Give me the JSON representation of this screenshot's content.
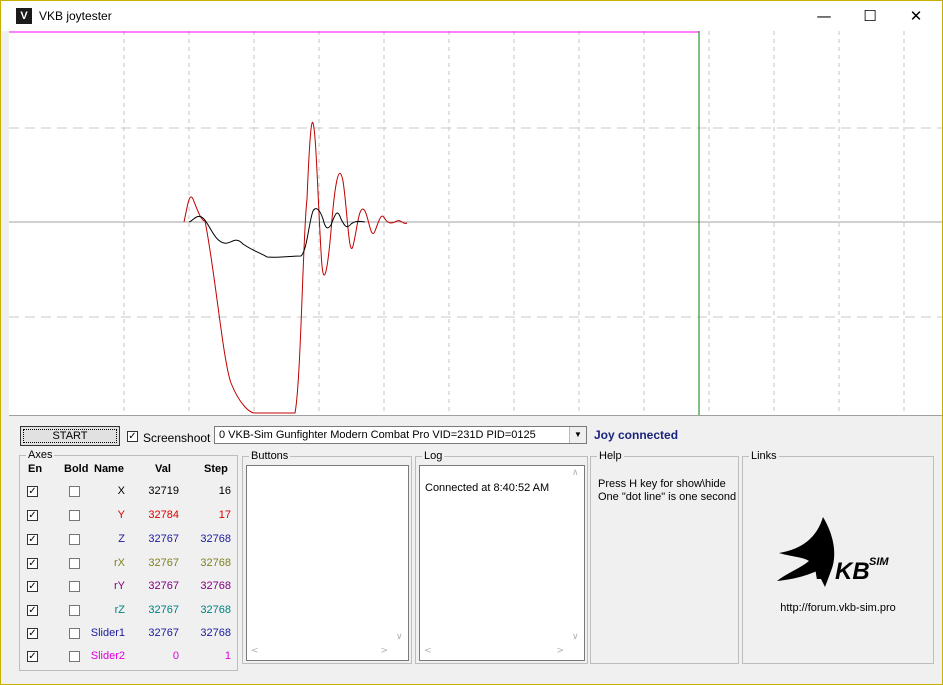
{
  "window": {
    "title": "VKB joytester",
    "min_glyph": "—",
    "max_glyph": "☐",
    "close_glyph": "✕"
  },
  "toolbar": {
    "start_label": "START",
    "screenshoot_checked": true,
    "screenshoot_label": "Screenshoot",
    "device_selected": "0  VKB-Sim Gunfighter Modern Combat Pro  VID=231D PID=0125",
    "status": "Joy connected"
  },
  "axes": {
    "title": "Axes",
    "headers": {
      "en": "En",
      "bold": "Bold",
      "name": "Name",
      "val": "Val",
      "step": "Step"
    },
    "rows": [
      {
        "en": true,
        "bold": false,
        "name": "X",
        "val": "32719",
        "step": "16",
        "color": "#000000"
      },
      {
        "en": true,
        "bold": false,
        "name": "Y",
        "val": "32784",
        "step": "17",
        "color": "#e00000"
      },
      {
        "en": true,
        "bold": false,
        "name": "Z",
        "val": "32767",
        "step": "32768",
        "color": "#1a1aa0"
      },
      {
        "en": true,
        "bold": false,
        "name": "rX",
        "val": "32767",
        "step": "32768",
        "color": "#808020"
      },
      {
        "en": true,
        "bold": false,
        "name": "rY",
        "val": "32767",
        "step": "32768",
        "color": "#800080"
      },
      {
        "en": true,
        "bold": false,
        "name": "rZ",
        "val": "32767",
        "step": "32768",
        "color": "#008080"
      },
      {
        "en": true,
        "bold": false,
        "name": "Slider1",
        "val": "32767",
        "step": "32768",
        "color": "#1a1aa0"
      },
      {
        "en": true,
        "bold": false,
        "name": "Slider2",
        "val": "0",
        "step": "1",
        "color": "#e000e0"
      }
    ]
  },
  "buttons": {
    "title": "Buttons"
  },
  "log": {
    "title": "Log",
    "entries": [
      "Connected at 8:40:52 AM"
    ]
  },
  "help": {
    "title": "Help",
    "lines": [
      "Press H key for show\\hide",
      "One \"dot line\" is one second"
    ]
  },
  "links": {
    "title": "Links",
    "url": "http://forum.vkb-sim.pro",
    "logo_text": "KB",
    "logo_sup": "SIM"
  },
  "plot": {
    "colors": {
      "top_line": "#ff00ff",
      "cursor": "#008000",
      "center": "#a0a0a0",
      "grid": "#c0c0c0",
      "x_trace": "#000000",
      "y_trace": "#c00000"
    }
  }
}
